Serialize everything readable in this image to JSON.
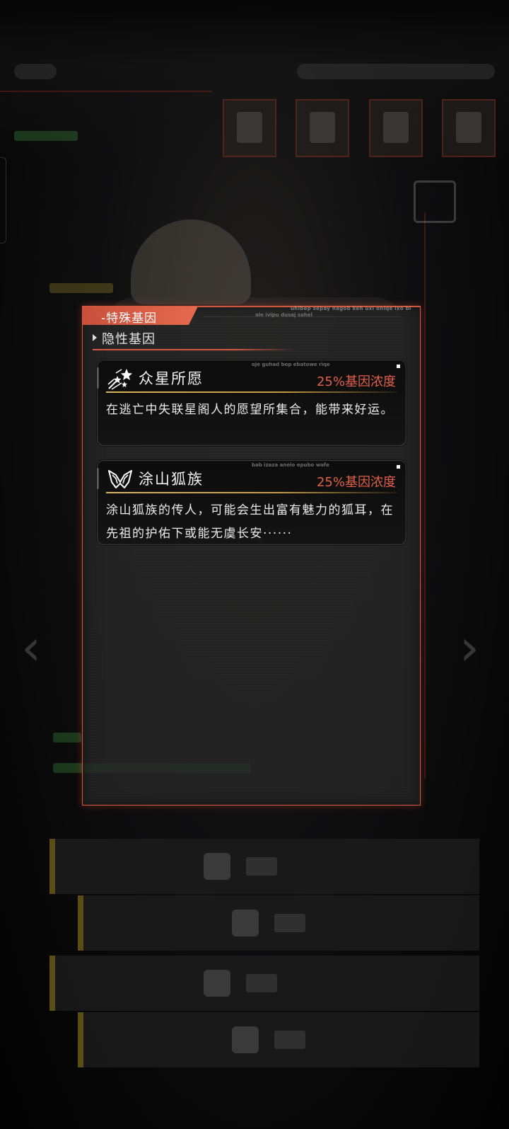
{
  "panel": {
    "tab_label": "-特殊基因",
    "deco_text_1": "uhibep sepay nagob keh uxi oniqe ixo bi",
    "deco_text_2": "ale ivipu dusaj sahel",
    "section_label": "隐性基因"
  },
  "genes": [
    {
      "icon": "shooting-stars-icon",
      "name": "众星所愿",
      "concentration": "25%基因浓度",
      "description": "在逃亡中失联星阁人的愿望所集合，能带来好运。",
      "deco_text": "oje guhad bop ebatowe riqe"
    },
    {
      "icon": "fox-ears-icon",
      "name": "涂山狐族",
      "concentration": "25%基因浓度",
      "description": "涂山狐族的传人，可能会生出富有魅力的狐耳，在先祖的护佑下或能无虞长安······",
      "deco_text": "bab izaza anelo epubo wafe"
    }
  ],
  "colors": {
    "accent": "#d8573f",
    "concentration": "#e2604a",
    "gold_rule": "#d9b25a"
  }
}
